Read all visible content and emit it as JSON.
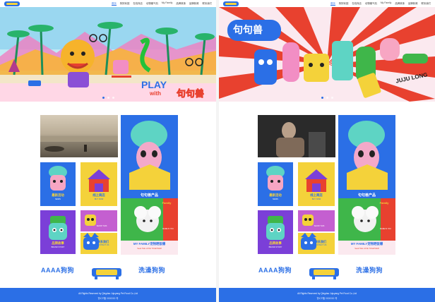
{
  "nav": {
    "items": [
      "首页",
      "狗狗军团",
      "在线商店",
      "动物暖气机",
      "My Family",
      "品牌故事",
      "品牌新闻",
      "联系我们"
    ]
  },
  "hero_left": {
    "title_word": "PLAY",
    "title_with": "with",
    "title_brand": "句句兽"
  },
  "hero_right": {
    "brand": "句句兽",
    "brand_en": "JUJU LONG"
  },
  "tiles": {
    "product_cn": "句句兽产品",
    "product_en": "JUJULONG PRODUCT",
    "news_cn": "最新活动",
    "news_en": "NEWS",
    "shop_cn": "线上商店",
    "shop_en": "BUY NOW",
    "story_cn": "品牌故事",
    "story_en": "BRAND STORY",
    "contact_cn": "联系我们",
    "contact_en": "CONTACT US",
    "family_cn": "MY FAMILY宠物晒饭爆",
    "family_en": "Seek THE LOVE TOGETHER",
    "family_badge": "Family",
    "small_label": "SHOW THIS",
    "made_in": "MADE IN YOU"
  },
  "brands": {
    "left": "AAAA狗狗",
    "right": "洗澡狗狗"
  },
  "footer": {
    "line1": "All Rights Reserved by Qingdao Jujuyang Pet Food Co.,Ltd",
    "line2": "鲁ICP备 0000000 号"
  },
  "colors": {
    "primary": "#2b6fe6",
    "yellow": "#f4d23a",
    "green": "#3fb64a",
    "purple": "#7b3fd8",
    "red": "#e8412f",
    "teal": "#5ed4c4"
  }
}
